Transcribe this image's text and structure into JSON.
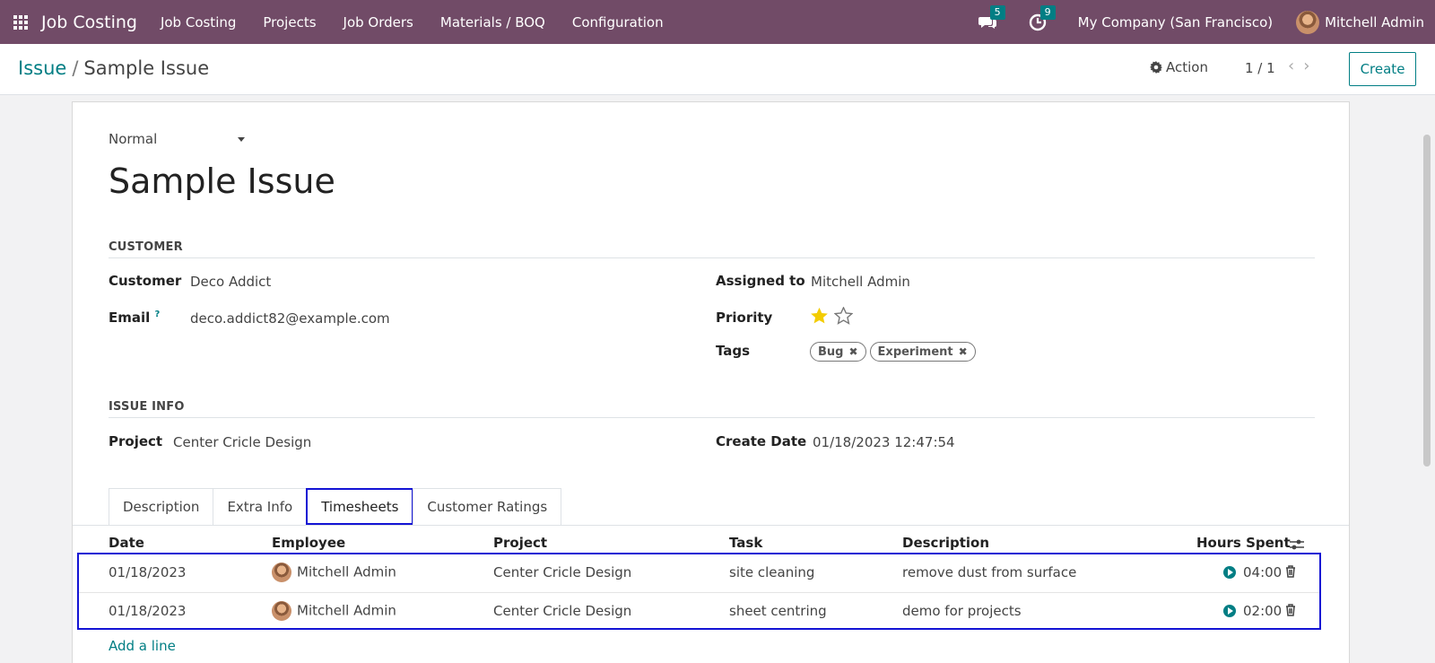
{
  "nav": {
    "brand": "Job Costing",
    "menu": [
      "Job Costing",
      "Projects",
      "Job Orders",
      "Materials / BOQ",
      "Configuration"
    ],
    "messages_count": "5",
    "activities_count": "9",
    "company": "My Company (San Francisco)",
    "user": "Mitchell Admin"
  },
  "control": {
    "breadcrumb_parent": "Issue",
    "breadcrumb_sep": "/",
    "breadcrumb_current": "Sample Issue",
    "action_label": "Action",
    "pager": "1 / 1",
    "create_label": "Create"
  },
  "form": {
    "status": "Normal",
    "title": "Sample Issue",
    "customer_section": "CUSTOMER",
    "customer_label": "Customer",
    "customer_value": "Deco Addict",
    "email_label": "Email",
    "email_help": "?",
    "email_value": "deco.addict82@example.com",
    "assigned_label": "Assigned to",
    "assigned_value": "Mitchell Admin",
    "priority_label": "Priority",
    "priority_stars": 1,
    "tags_label": "Tags",
    "tags": [
      "Bug",
      "Experiment"
    ],
    "issue_section": "ISSUE INFO",
    "project_label": "Project",
    "project_value": "Center Cricle Design",
    "create_date_label": "Create Date",
    "create_date_value": "01/18/2023 12:47:54"
  },
  "tabs": [
    "Description",
    "Extra Info",
    "Timesheets",
    "Customer Ratings"
  ],
  "timesheets": {
    "columns": [
      "Date",
      "Employee",
      "Project",
      "Task",
      "Description",
      "Hours Spent"
    ],
    "rows": [
      {
        "date": "01/18/2023",
        "employee": "Mitchell Admin",
        "project": "Center Cricle Design",
        "task": "site cleaning",
        "description": "remove dust from surface",
        "hours": "04:00"
      },
      {
        "date": "01/18/2023",
        "employee": "Mitchell Admin",
        "project": "Center Cricle Design",
        "task": "sheet centring",
        "description": "demo for projects",
        "hours": "02:00"
      }
    ],
    "add_line": "Add a line"
  },
  "colors": {
    "brand": "#714b67",
    "accent": "#017e84",
    "highlight": "#1414d4",
    "star": "#f3cc00"
  }
}
